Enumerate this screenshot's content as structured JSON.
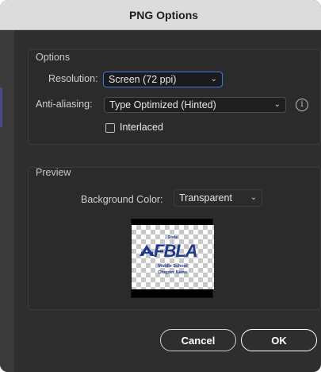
{
  "window": {
    "title": "PNG Options"
  },
  "options": {
    "group_label": "Options",
    "resolution": {
      "label": "Resolution:",
      "value": "Screen (72 ppi)"
    },
    "anti_aliasing": {
      "label": "Anti-aliasing:",
      "value": "Type Optimized (Hinted)"
    },
    "interlaced": {
      "label": "Interlaced",
      "checked": false
    },
    "info_icon": "info-circle-icon"
  },
  "preview": {
    "group_label": "Preview",
    "background_color": {
      "label": "Background Color:",
      "value": "Transparent"
    },
    "thumbnail": {
      "state_text": "State",
      "logo_text": "FBLA",
      "line1": "Middle School",
      "line2": "Chapter Name",
      "logo_color": "#1f3a8a"
    }
  },
  "buttons": {
    "cancel": "Cancel",
    "ok": "OK"
  },
  "colors": {
    "dialog_bg": "#2e2e2e",
    "title_bar_bg": "#dcdcdc",
    "focus_ring": "#3b78e7"
  }
}
